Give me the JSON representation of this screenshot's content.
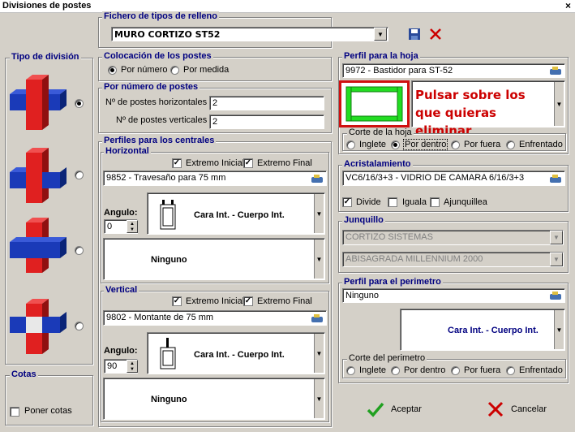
{
  "window": {
    "title": "Divisiones de postes",
    "close_glyph": "×"
  },
  "fichero": {
    "legend": "Fichero de tipos de relleno",
    "value": "MURO CORTIZO ST52"
  },
  "tipo_division": {
    "legend": "Tipo de división",
    "selected_index": 0
  },
  "cotas": {
    "legend": "Cotas",
    "poner_cotas": "Poner cotas",
    "checked": false
  },
  "colocacion": {
    "legend": "Colocación de los postes",
    "por_numero": "Por número",
    "por_medida": "Por medida",
    "selected": "por_numero"
  },
  "por_numero": {
    "legend": "Por número de postes",
    "horiz_label": "Nº de postes horizontales",
    "horiz_value": "2",
    "vert_label": "Nº de postes verticales",
    "vert_value": "2"
  },
  "perfiles_centrales": {
    "legend": "Perfiles para los centrales",
    "horizontal": {
      "legend": "Horizontal",
      "extremo_inicial": "Extremo Inicial",
      "extremo_final": "Extremo Final",
      "perfil": "9852 - Travesaño para 75 mm",
      "angulo_label": "Angulo:",
      "angulo_value": "0",
      "cara_text": "Cara Int. - Cuerpo Int.",
      "ninguno_text": "Ninguno"
    },
    "vertical": {
      "legend": "Vertical",
      "extremo_inicial": "Extremo Inicial",
      "extremo_final": "Extremo Final",
      "perfil": "9802 - Montante de 75 mm",
      "angulo_label": "Angulo:",
      "angulo_value": "90",
      "cara_text": "Cara Int. - Cuerpo Int.",
      "ninguno_text": "Ninguno"
    }
  },
  "perfil_hoja": {
    "legend": "Perfil para la hoja",
    "value": "9972 - Bastidor para ST-52",
    "hint": "Pulsar sobre los que quieras eliminar"
  },
  "corte_hoja": {
    "legend": "Corte de la hoja",
    "options": [
      "Inglete",
      "Por dentro",
      "Por fuera",
      "Enfrentado"
    ],
    "selected_index": 1
  },
  "acristalamiento": {
    "legend": "Acristalamiento",
    "value": "VC6/16/3+3 - VIDRIO DE CAMARA 6/16/3+3",
    "divide": "Divide",
    "iguala": "Iguala",
    "ajunquillea": "Ajunquillea"
  },
  "junquillo": {
    "legend": "Junquillo",
    "value1": "CORTIZO SISTEMAS",
    "value2": "ABISAGRADA MILLENNIUM 2000"
  },
  "perfil_perimetro": {
    "legend": "Perfil para el perimetro",
    "value": "Ninguno",
    "cara_text": "Cara Int. - Cuerpo Int."
  },
  "corte_perimetro": {
    "legend": "Corte del perimetro",
    "options": [
      "Inglete",
      "Por dentro",
      "Por fuera",
      "Enfrentado"
    ]
  },
  "buttons": {
    "aceptar": "Aceptar",
    "cancelar": "Cancelar"
  },
  "colors": {
    "accent": "#000080",
    "hint_red": "#cc0000",
    "profile_green": "#22dd22"
  }
}
